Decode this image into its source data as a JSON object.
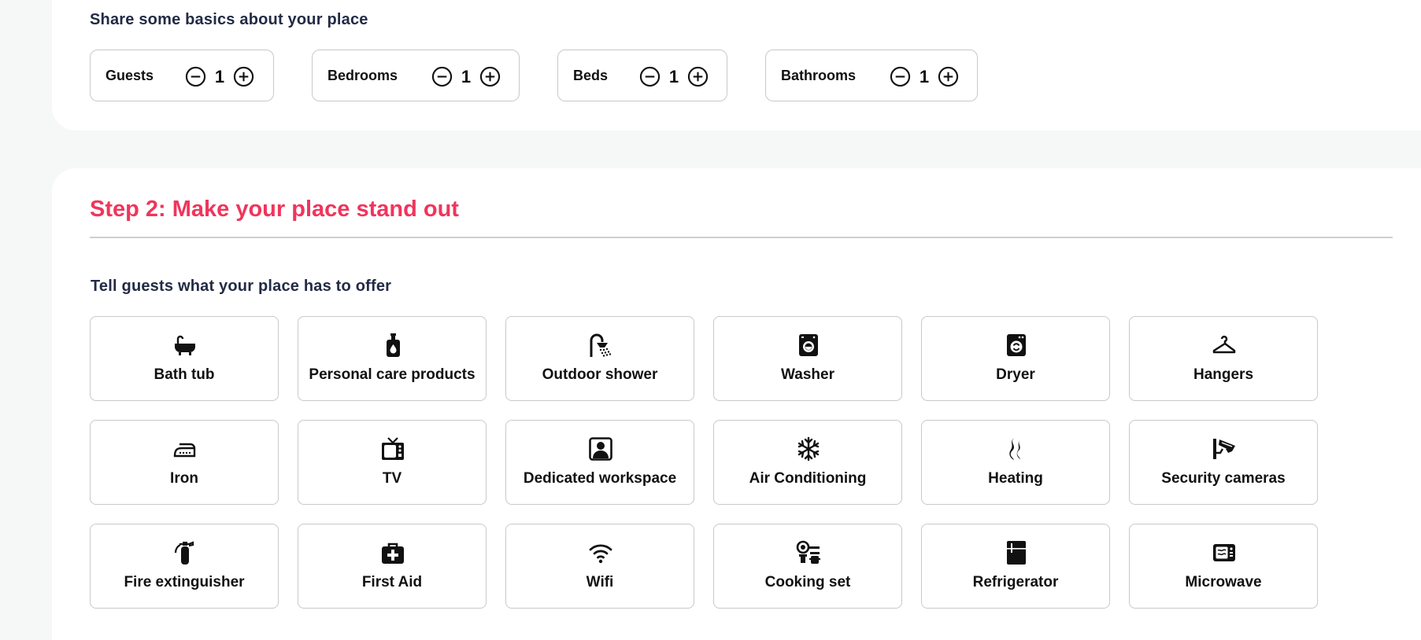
{
  "basics": {
    "heading": "Share some basics about your place",
    "counters": [
      {
        "label": "Guests",
        "value": "1"
      },
      {
        "label": "Bedrooms",
        "value": "1"
      },
      {
        "label": "Beds",
        "value": "1"
      },
      {
        "label": "Bathrooms",
        "value": "1"
      }
    ]
  },
  "step2": {
    "title": "Step 2: Make your place stand out",
    "offer_heading": "Tell guests what your place has to offer",
    "amenities": [
      {
        "label": "Bath tub",
        "icon": "bathtub-icon"
      },
      {
        "label": "Personal care products",
        "icon": "soap-dispenser-icon"
      },
      {
        "label": "Outdoor shower",
        "icon": "shower-icon"
      },
      {
        "label": "Washer",
        "icon": "washer-icon"
      },
      {
        "label": "Dryer",
        "icon": "dryer-icon"
      },
      {
        "label": "Hangers",
        "icon": "hanger-icon"
      },
      {
        "label": "Iron",
        "icon": "iron-icon"
      },
      {
        "label": "TV",
        "icon": "tv-icon"
      },
      {
        "label": "Dedicated workspace",
        "icon": "workspace-icon"
      },
      {
        "label": "Air Conditioning",
        "icon": "snowflake-icon"
      },
      {
        "label": "Heating",
        "icon": "heat-icon"
      },
      {
        "label": "Security cameras",
        "icon": "security-camera-icon"
      },
      {
        "label": "Fire extinguisher",
        "icon": "fire-extinguisher-icon"
      },
      {
        "label": "First Aid",
        "icon": "first-aid-kit-icon"
      },
      {
        "label": "Wifi",
        "icon": "wifi-icon"
      },
      {
        "label": "Cooking set",
        "icon": "cooking-set-icon"
      },
      {
        "label": "Refrigerator",
        "icon": "refrigerator-icon"
      },
      {
        "label": "Microwave",
        "icon": "microwave-icon"
      }
    ]
  },
  "colors": {
    "accent": "#f0355c",
    "heading": "#222b45",
    "border": "#c9c9c9",
    "background": "#f6f7f7"
  }
}
